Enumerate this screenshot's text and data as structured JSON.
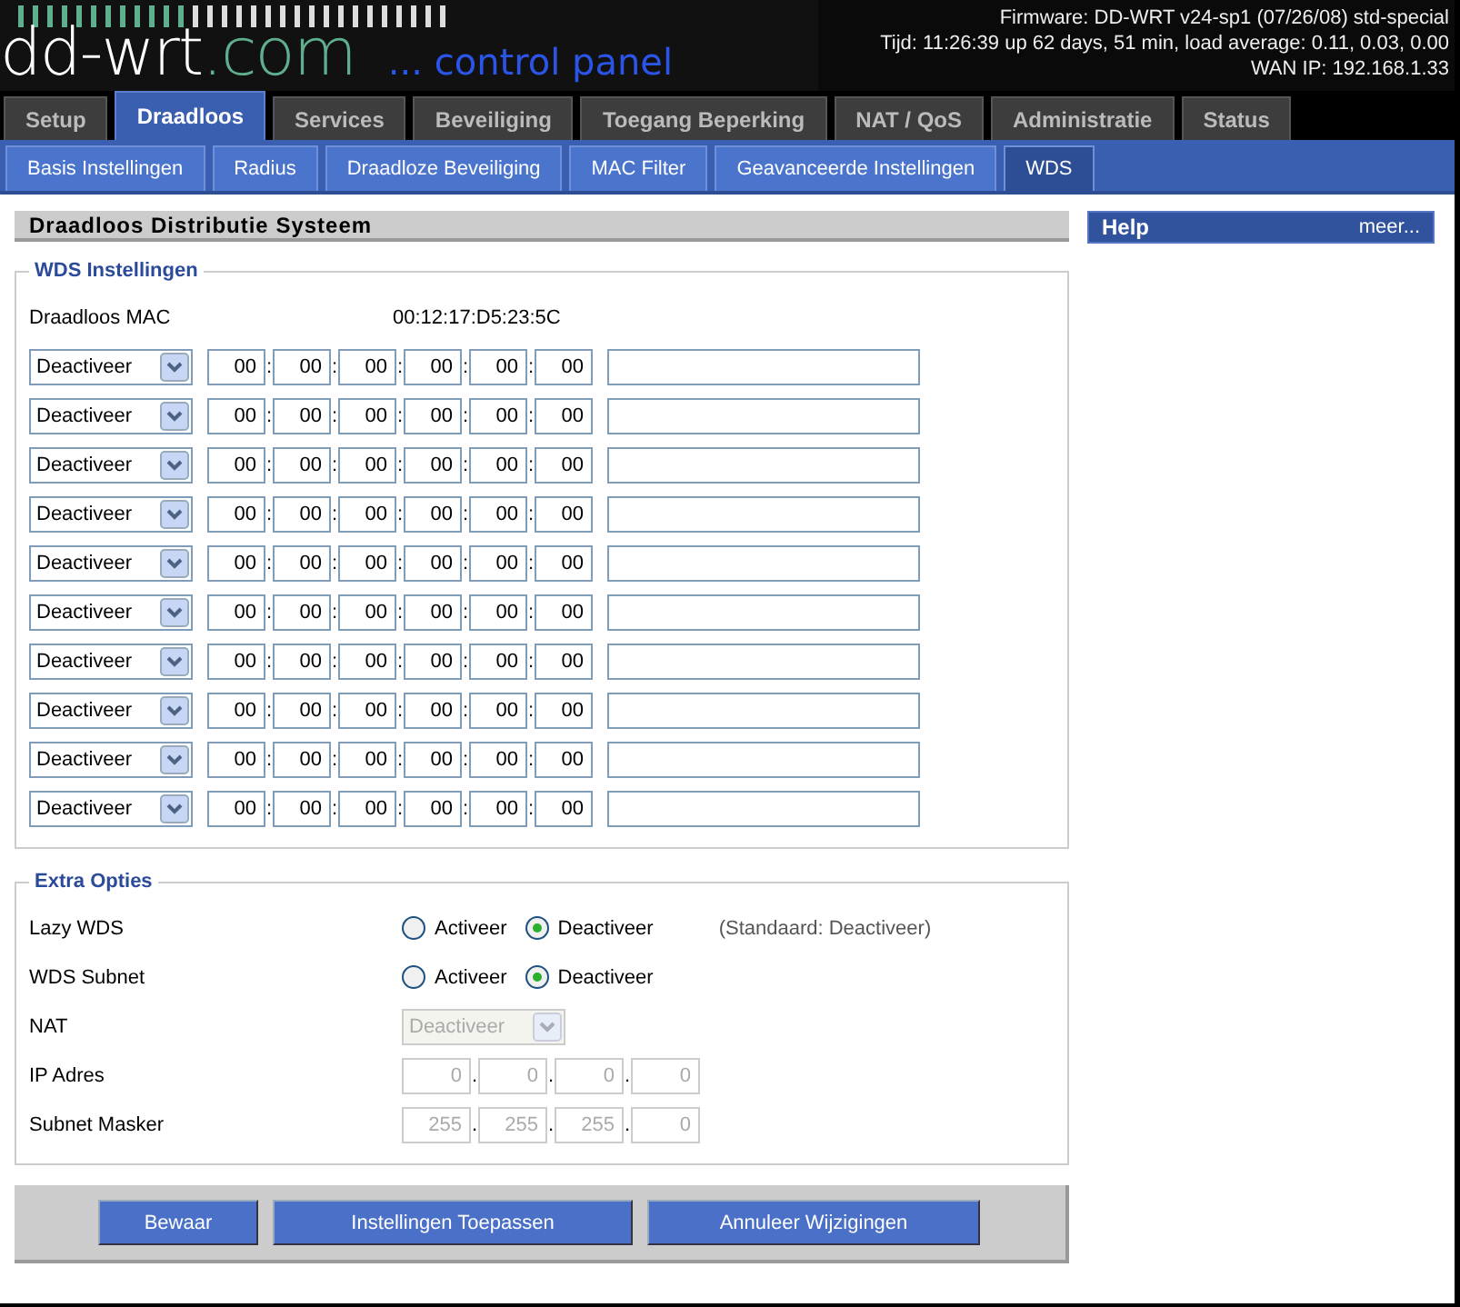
{
  "header": {
    "logo_main": "dd-wrt",
    "logo_suffix": ".com",
    "logo_tagline": "... control panel",
    "info": [
      "Firmware: DD-WRT v24-sp1 (07/26/08) std-special",
      "Tijd: 11:26:39 up 62 days, 51 min, load average: 0.11, 0.03, 0.00",
      "WAN IP: 192.168.1.33"
    ]
  },
  "tabs": [
    {
      "label": "Setup",
      "selected": false
    },
    {
      "label": "Draadloos",
      "selected": true
    },
    {
      "label": "Services",
      "selected": false
    },
    {
      "label": "Beveiliging",
      "selected": false
    },
    {
      "label": "Toegang Beperking",
      "selected": false
    },
    {
      "label": "NAT / QoS",
      "selected": false
    },
    {
      "label": "Administratie",
      "selected": false
    },
    {
      "label": "Status",
      "selected": false
    }
  ],
  "subtabs": [
    {
      "label": "Basis Instellingen",
      "selected": false
    },
    {
      "label": "Radius",
      "selected": false
    },
    {
      "label": "Draadloze Beveiliging",
      "selected": false
    },
    {
      "label": "MAC Filter",
      "selected": false
    },
    {
      "label": "Geavanceerde Instellingen",
      "selected": false
    },
    {
      "label": "WDS",
      "selected": true
    }
  ],
  "section_title": "Draadloos Distributie Systeem",
  "wds": {
    "legend": "WDS Instellingen",
    "mac_label": "Draadloos MAC",
    "mac_value": "00:12:17:D5:23:5C",
    "separator": ":",
    "rows": [
      {
        "mode": "Deactiveer",
        "mac": [
          "00",
          "00",
          "00",
          "00",
          "00",
          "00"
        ]
      },
      {
        "mode": "Deactiveer",
        "mac": [
          "00",
          "00",
          "00",
          "00",
          "00",
          "00"
        ]
      },
      {
        "mode": "Deactiveer",
        "mac": [
          "00",
          "00",
          "00",
          "00",
          "00",
          "00"
        ]
      },
      {
        "mode": "Deactiveer",
        "mac": [
          "00",
          "00",
          "00",
          "00",
          "00",
          "00"
        ]
      },
      {
        "mode": "Deactiveer",
        "mac": [
          "00",
          "00",
          "00",
          "00",
          "00",
          "00"
        ]
      },
      {
        "mode": "Deactiveer",
        "mac": [
          "00",
          "00",
          "00",
          "00",
          "00",
          "00"
        ]
      },
      {
        "mode": "Deactiveer",
        "mac": [
          "00",
          "00",
          "00",
          "00",
          "00",
          "00"
        ]
      },
      {
        "mode": "Deactiveer",
        "mac": [
          "00",
          "00",
          "00",
          "00",
          "00",
          "00"
        ]
      },
      {
        "mode": "Deactiveer",
        "mac": [
          "00",
          "00",
          "00",
          "00",
          "00",
          "00"
        ]
      },
      {
        "mode": "Deactiveer",
        "mac": [
          "00",
          "00",
          "00",
          "00",
          "00",
          "00"
        ]
      }
    ]
  },
  "extra": {
    "legend": "Extra Opties",
    "separator": ".",
    "rows": [
      {
        "kind": "radio",
        "label": "Lazy WDS",
        "options": [
          {
            "label": "Activeer",
            "selected": false
          },
          {
            "label": "Deactiveer",
            "selected": true
          }
        ],
        "note": "(Standaard: Deactiveer)"
      },
      {
        "kind": "radio",
        "label": "WDS Subnet",
        "options": [
          {
            "label": "Activeer",
            "selected": false
          },
          {
            "label": "Deactiveer",
            "selected": true
          }
        ]
      },
      {
        "kind": "select",
        "label": "NAT",
        "value": "Deactiveer",
        "disabled": true
      },
      {
        "kind": "ip",
        "label": "IP Adres",
        "octets": [
          "0",
          "0",
          "0",
          "0"
        ],
        "disabled": true
      },
      {
        "kind": "ip",
        "label": "Subnet Masker",
        "octets": [
          "255",
          "255",
          "255",
          "0"
        ],
        "disabled": true
      }
    ]
  },
  "help": {
    "title": "Help",
    "link": "meer..."
  },
  "buttons": [
    "Bewaar",
    "Instellingen Toepassen",
    "Annuleer Wijzigingen"
  ]
}
